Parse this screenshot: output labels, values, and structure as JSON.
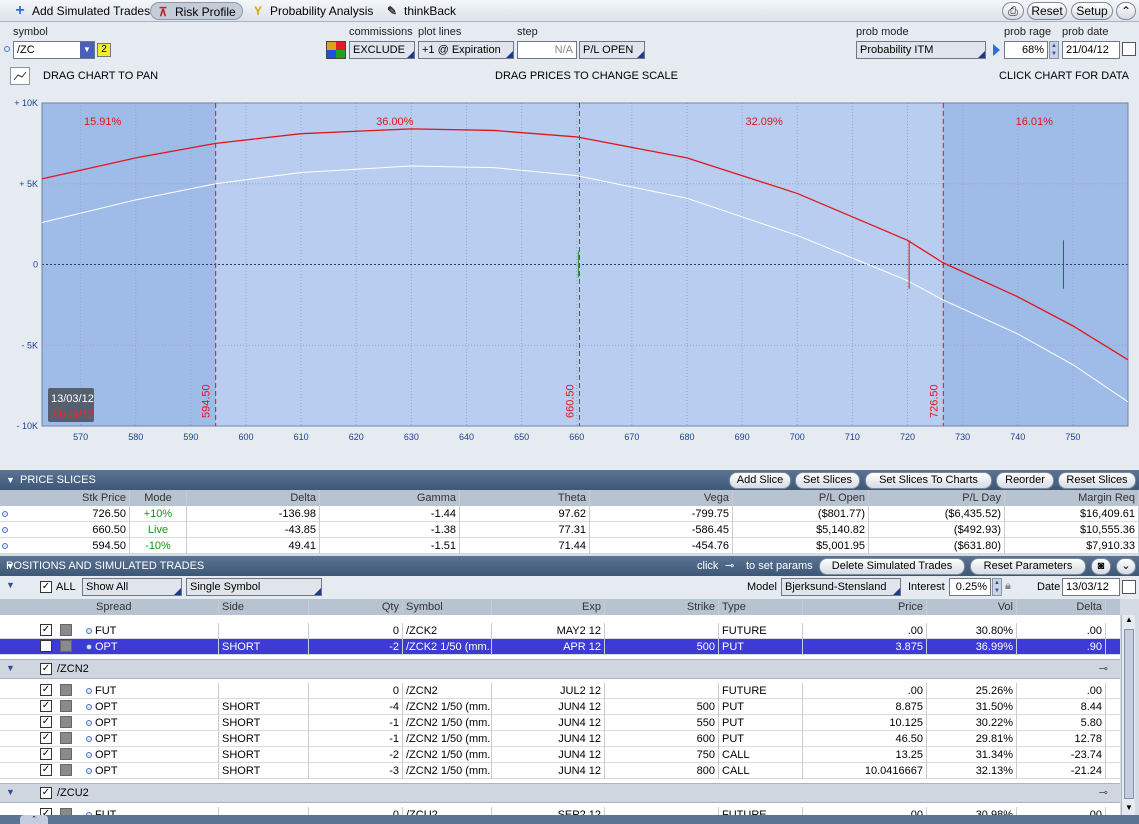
{
  "tabs": [
    {
      "label": "Add Simulated Trades",
      "icon": "plus-icon",
      "active": false
    },
    {
      "label": "Risk Profile",
      "icon": "risk-profile-icon",
      "active": true
    },
    {
      "label": "Probability Analysis",
      "icon": "probability-icon",
      "active": false
    },
    {
      "label": "thinkBack",
      "icon": "thinkback-icon",
      "active": false
    }
  ],
  "toolbar": {
    "reset": "Reset",
    "setup": "Setup"
  },
  "params": {
    "symbol_label": "symbol",
    "symbol": "/ZC",
    "symbol_badge": "2",
    "commissions_label": "commissions",
    "commissions": "EXCLUDE",
    "plot_lines_label": "plot lines",
    "plot_lines": "+1 @ Expiration",
    "step_label": "step",
    "step": "N/A",
    "pl_mode": "P/L OPEN",
    "prob_mode_label": "prob mode",
    "prob_mode": "Probability ITM",
    "prob_range_label": "prob rage",
    "prob_range": "68%",
    "prob_date_label": "prob date",
    "prob_date": "21/04/12"
  },
  "chart_hints": {
    "left": "DRAG CHART TO PAN",
    "center": "DRAG PRICES TO CHANGE SCALE",
    "right": "CLICK CHART FOR DATA"
  },
  "chart_data": {
    "type": "line",
    "xlim": [
      563,
      760
    ],
    "ylim": [
      -10000,
      10000
    ],
    "x_ticks": [
      570,
      580,
      590,
      600,
      610,
      620,
      630,
      640,
      650,
      660,
      670,
      680,
      690,
      700,
      710,
      720,
      730,
      740,
      750
    ],
    "y_ticks": [
      {
        "v": 10000,
        "label": "+ 10K"
      },
      {
        "v": 5000,
        "label": "+ 5K"
      },
      {
        "v": 0,
        "label": "0"
      },
      {
        "v": -5000,
        "label": "- 5K"
      },
      {
        "v": -10000,
        "label": "- 10K"
      }
    ],
    "series": [
      {
        "color": "#e0161a",
        "x": [
          563,
          580,
          594.5,
          610,
          630,
          645,
          660,
          680,
          700,
          720,
          726.5,
          740,
          750,
          760
        ],
        "y": [
          5300,
          6600,
          7500,
          8100,
          8400,
          8300,
          7900,
          6600,
          4400,
          1500,
          100,
          -2000,
          -3800,
          -5900
        ]
      },
      {
        "color": "#ffffff",
        "x": [
          563,
          580,
          594.5,
          610,
          630,
          645,
          660,
          680,
          700,
          720,
          726.5,
          740,
          750,
          760
        ],
        "y": [
          2600,
          4000,
          5000,
          5700,
          6100,
          6000,
          5500,
          4100,
          1800,
          -1000,
          -2200,
          -4300,
          -6200,
          -8500
        ]
      }
    ],
    "prob_regions": [
      {
        "label": "15.91%",
        "x": 574
      },
      {
        "label": "36.00%",
        "x": 627
      },
      {
        "label": "32.09%",
        "x": 694
      },
      {
        "label": "16.01%",
        "x": 743
      }
    ],
    "slice_lines": [
      {
        "x": 594.5,
        "label": "594.50"
      },
      {
        "x": 660.5,
        "label": "660.50"
      },
      {
        "x": 726.5,
        "label": "726.50"
      }
    ],
    "date_legend": [
      "13/03/12",
      "21/04/12"
    ]
  },
  "price_slices": {
    "title": "PRICE SLICES",
    "buttons": [
      "Add Slice",
      "Set Slices",
      "Set Slices To Charts",
      "Reorder",
      "Reset Slices"
    ],
    "headers": [
      "Stk Price",
      "Mode",
      "Delta",
      "Gamma",
      "Theta",
      "Vega",
      "P/L Open",
      "P/L Day",
      "Margin Req"
    ],
    "rows": [
      [
        "726.50",
        "+10%",
        "-136.98",
        "-1.44",
        "97.62",
        "-799.75",
        "($801.77)",
        "($6,435.52)",
        "$16,409.61"
      ],
      [
        "660.50",
        "Live",
        "-43.85",
        "-1.38",
        "77.31",
        "-586.45",
        "$5,140.82",
        "($492.93)",
        "$10,555.36"
      ],
      [
        "594.50",
        "-10%",
        "49.41",
        "-1.51",
        "71.44",
        "-454.76",
        "$5,001.95",
        "($631.80)",
        "$7,910.33"
      ]
    ]
  },
  "positions": {
    "title": "POSITIONS AND SIMULATED TRADES",
    "click_hint": "click",
    "click_hint2": "to set params",
    "buttons": [
      "Delete Simulated Trades",
      "Reset Parameters"
    ],
    "all_label": "ALL",
    "show_filter": "Show All",
    "symbol_filter": "Single Symbol",
    "model_label": "Model",
    "model": "Bjerksund-Stensland",
    "interest_label": "Interest",
    "interest": "0.25%",
    "date_label": "Date",
    "date": "13/03/12",
    "headers": [
      "Spread",
      "Side",
      "Qty",
      "Symbol",
      "Exp",
      "Strike",
      "Type",
      "Price",
      "Vol",
      "Delta"
    ],
    "groups": [
      {
        "name": "/ZCK2",
        "rows": [
          [
            "FUT",
            "",
            "0",
            "/ZCK2",
            "MAY2 12",
            "",
            "FUTURE",
            ".00",
            "30.80%",
            ".00"
          ],
          [
            "OPT",
            "SHORT",
            "-2",
            "/ZCK2 1/50 (mm...",
            "APR 12",
            "500",
            "PUT",
            "3.875",
            "36.99%",
            ".90"
          ]
        ]
      },
      {
        "name": "/ZCN2",
        "rows": [
          [
            "FUT",
            "",
            "0",
            "/ZCN2",
            "JUL2 12",
            "",
            "FUTURE",
            ".00",
            "25.26%",
            ".00"
          ],
          [
            "OPT",
            "SHORT",
            "-4",
            "/ZCN2 1/50 (mm...",
            "JUN4 12",
            "500",
            "PUT",
            "8.875",
            "31.50%",
            "8.44"
          ],
          [
            "OPT",
            "SHORT",
            "-1",
            "/ZCN2 1/50 (mm...",
            "JUN4 12",
            "550",
            "PUT",
            "10.125",
            "30.22%",
            "5.80"
          ],
          [
            "OPT",
            "SHORT",
            "-1",
            "/ZCN2 1/50 (mm...",
            "JUN4 12",
            "600",
            "PUT",
            "46.50",
            "29.81%",
            "12.78"
          ],
          [
            "OPT",
            "SHORT",
            "-2",
            "/ZCN2 1/50 (mm...",
            "JUN4 12",
            "750",
            "CALL",
            "13.25",
            "31.34%",
            "-23.74"
          ],
          [
            "OPT",
            "SHORT",
            "-3",
            "/ZCN2 1/50 (mm...",
            "JUN4 12",
            "800",
            "CALL",
            "10.0416667",
            "32.13%",
            "-21.24"
          ]
        ]
      },
      {
        "name": "/ZCU2",
        "rows": [
          [
            "FUT",
            "",
            "0",
            "/ZCU2",
            "SEP2 12",
            "",
            "FUTURE",
            ".00",
            "30.98%",
            ".00"
          ]
        ]
      }
    ],
    "selected_row": "1"
  },
  "colors": {
    "header_bg": "#4a6282",
    "selected_row": "#3d3ad8",
    "positive": "#119a11",
    "red": "#e0161a"
  }
}
